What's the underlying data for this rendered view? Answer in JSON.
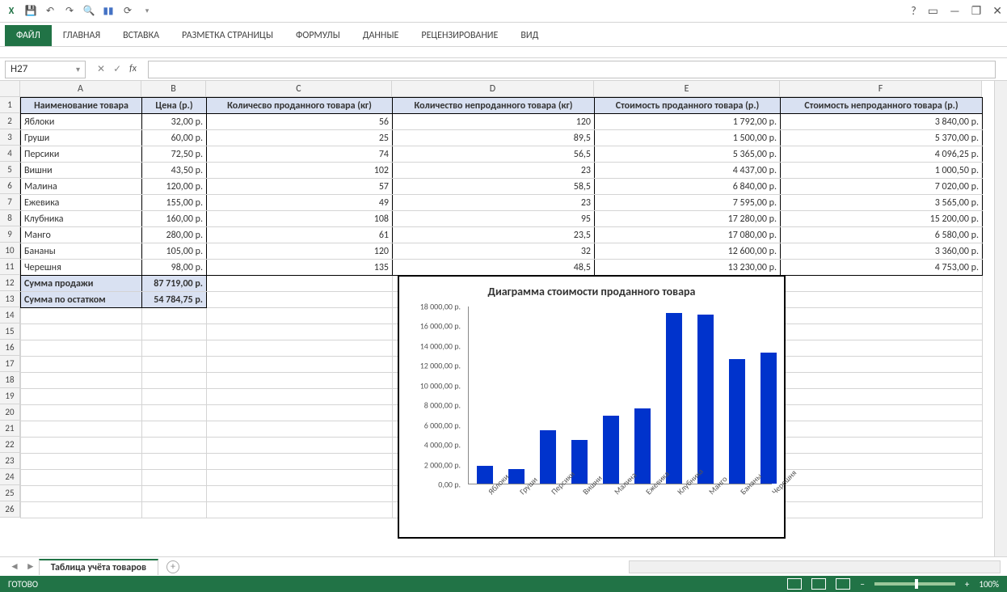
{
  "app": {
    "help": "?",
    "min": "—",
    "max": "❐",
    "close": "✕",
    "restore": "▭"
  },
  "ribbon": {
    "file": "ФАЙЛ",
    "tabs": [
      "ГЛАВНАЯ",
      "ВСТАВКА",
      "РАЗМЕТКА СТРАНИЦЫ",
      "ФОРМУЛЫ",
      "ДАННЫЕ",
      "РЕЦЕНЗИРОВАНИЕ",
      "ВИД"
    ]
  },
  "namebox": "H27",
  "fx": "fx",
  "columns": [
    "A",
    "B",
    "C",
    "D",
    "E",
    "F"
  ],
  "headers": {
    "A": "Наименование товара",
    "B": "Цена (р.)",
    "C": "Количесво проданного товара (кг)",
    "D": "Количество непроданного товара (кг)",
    "E": "Стоимость проданного товара (р.)",
    "F": "Стоимость непроданного товара (р.)"
  },
  "rows": [
    {
      "A": "Яблоки",
      "B": "32,00 р.",
      "C": "56",
      "D": "120",
      "E": "1 792,00 р.",
      "F": "3 840,00 р."
    },
    {
      "A": "Груши",
      "B": "60,00 р.",
      "C": "25",
      "D": "89,5",
      "E": "1 500,00 р.",
      "F": "5 370,00 р."
    },
    {
      "A": "Персики",
      "B": "72,50 р.",
      "C": "74",
      "D": "56,5",
      "E": "5 365,00 р.",
      "F": "4 096,25 р."
    },
    {
      "A": "Вишни",
      "B": "43,50 р.",
      "C": "102",
      "D": "23",
      "E": "4 437,00 р.",
      "F": "1 000,50 р."
    },
    {
      "A": "Малина",
      "B": "120,00 р.",
      "C": "57",
      "D": "58,5",
      "E": "6 840,00 р.",
      "F": "7 020,00 р."
    },
    {
      "A": "Ежевика",
      "B": "155,00 р.",
      "C": "49",
      "D": "23",
      "E": "7 595,00 р.",
      "F": "3 565,00 р."
    },
    {
      "A": "Клубника",
      "B": "160,00 р.",
      "C": "108",
      "D": "95",
      "E": "17 280,00 р.",
      "F": "15 200,00 р."
    },
    {
      "A": "Манго",
      "B": "280,00 р.",
      "C": "61",
      "D": "23,5",
      "E": "17 080,00 р.",
      "F": "6 580,00 р."
    },
    {
      "A": "Бананы",
      "B": "105,00 р.",
      "C": "120",
      "D": "32",
      "E": "12 600,00 р.",
      "F": "3 360,00 р."
    },
    {
      "A": "Черешня",
      "B": "98,00 р.",
      "C": "135",
      "D": "48,5",
      "E": "13 230,00 р.",
      "F": "4 753,00 р."
    }
  ],
  "summary": [
    {
      "label": "Сумма продажи",
      "value": "87 719,00 р."
    },
    {
      "label": "Сумма по остатком",
      "value": "54 784,75 р."
    }
  ],
  "sheet_tab": "Таблица учёта товаров",
  "status": "ГОТОВО",
  "zoom": "100%",
  "chart_data": {
    "type": "bar",
    "title": "Диаграмма стоимости проданного товара",
    "categories": [
      "Яблоки",
      "Груши",
      "Персики",
      "Вишни",
      "Малина",
      "Ежевика",
      "Клубника",
      "Манго",
      "Бананы",
      "Черешня"
    ],
    "values": [
      1792,
      1500,
      5365,
      4437,
      6840,
      7595,
      17280,
      17080,
      12600,
      13230
    ],
    "ylim": [
      0,
      18000
    ],
    "yticks": [
      "0,00 р.",
      "2 000,00 р.",
      "4 000,00 р.",
      "6 000,00 р.",
      "8 000,00 р.",
      "10 000,00 р.",
      "12 000,00 р.",
      "14 000,00 р.",
      "16 000,00 р.",
      "18 000,00 р."
    ]
  }
}
